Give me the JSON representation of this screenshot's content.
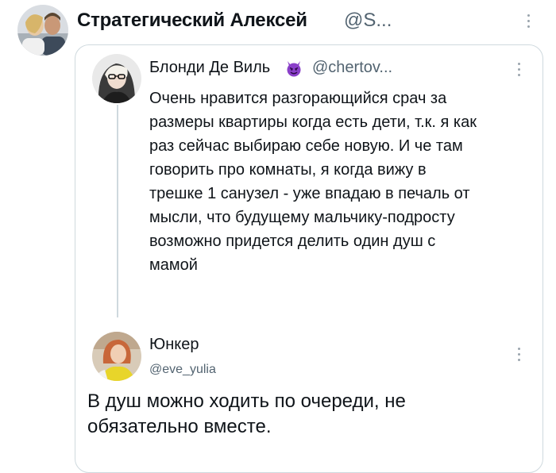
{
  "outer_tweet": {
    "author_name": "Стратегический Алексей",
    "author_handle": "@S...",
    "avatar_icon": "profile-avatar-icon"
  },
  "quoted_tweet": {
    "author_name": "Блонди Де Виль",
    "author_handle": "@chertov...",
    "name_emoji": "smiling-devil-icon",
    "avatar_icon": "profile-avatar-icon",
    "text_lines": [
      "Очень нравится разгорающийся срач за",
      "размеры квартиры когда есть дети, т.к. я как",
      "раз сейчас выбираю себе новую. И че там",
      "говорить про комнаты, я когда вижу в",
      "трешке 1 санузел - уже впадаю в печаль от",
      "мысли, что будущему мальчику-подросту",
      "возможно придется делить один душ с",
      "мамой"
    ]
  },
  "reply_tweet": {
    "author_name": "Юнкер",
    "author_handle": "@eve_yulia",
    "avatar_icon": "profile-avatar-icon",
    "text_lines": [
      "В душ можно ходить по очереди, не",
      "обязательно вместе."
    ]
  },
  "colors": {
    "text_primary": "#0f1419",
    "text_secondary": "#536471",
    "border": "#cfd9de",
    "emoji_purple": "#8a3fc9"
  },
  "icons": {
    "more_menu": "more-vertical-icon"
  }
}
